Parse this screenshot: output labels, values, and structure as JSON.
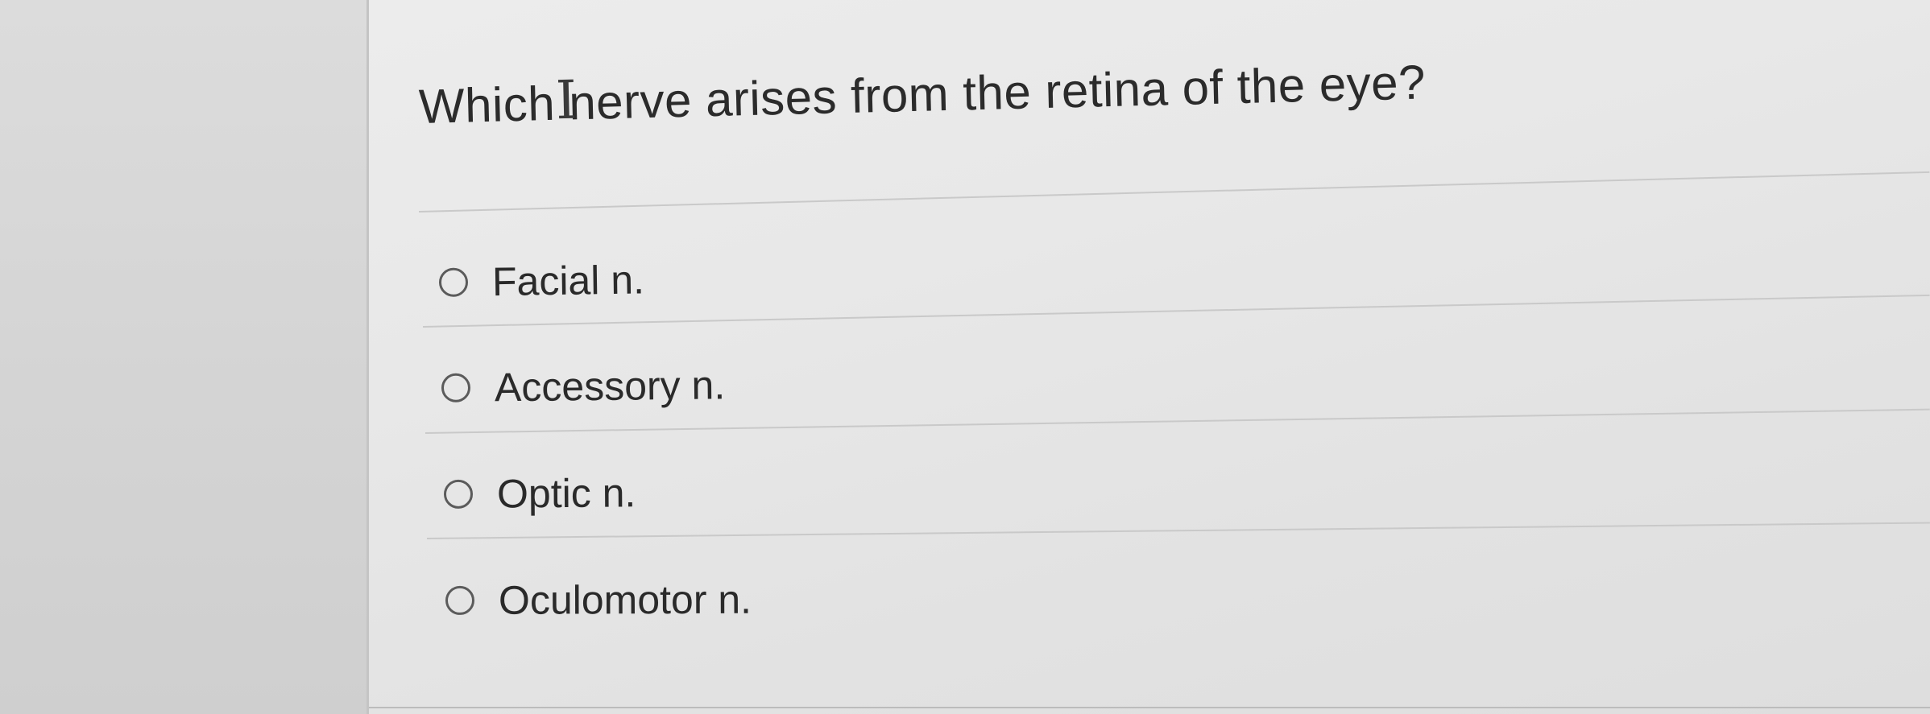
{
  "question": {
    "text": "Which nerve arises from the retina of the eye?"
  },
  "options": [
    {
      "label": "Facial n.",
      "selected": false
    },
    {
      "label": "Accessory n.",
      "selected": false
    },
    {
      "label": "Optic n.",
      "selected": false
    },
    {
      "label": "Oculomotor n.",
      "selected": false
    }
  ],
  "cursor": {
    "type": "text-i-beam",
    "glyph": "I"
  },
  "colors": {
    "panel_background": "#e8e8e8",
    "margin_background": "#d6d6d6",
    "text": "#2b2b2b",
    "radio_border": "#5b5b5b",
    "divider": "#c9c9c9"
  }
}
